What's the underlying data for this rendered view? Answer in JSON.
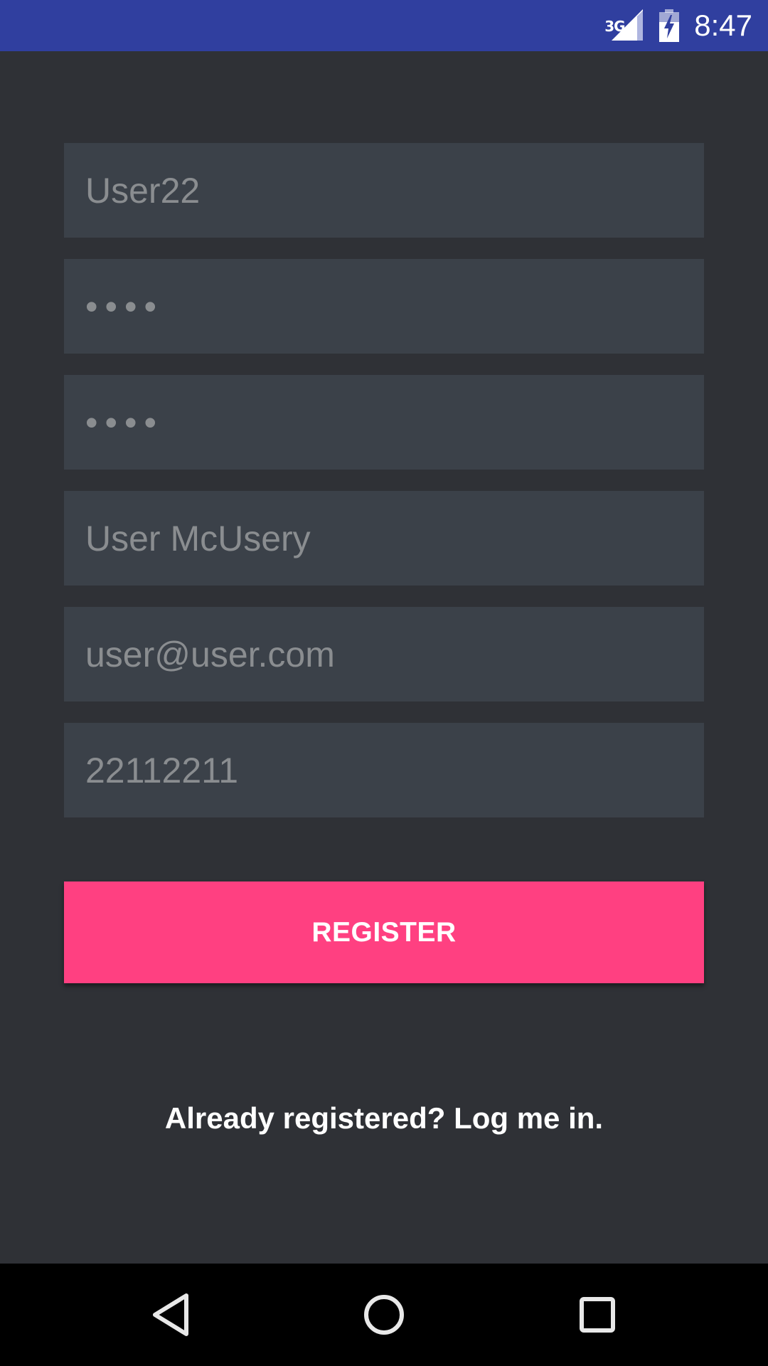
{
  "status_bar": {
    "network_type": "3G",
    "time": "8:47",
    "icons": [
      "signal-icon",
      "battery-charging-icon"
    ],
    "color": "#303f9f"
  },
  "form": {
    "fields": [
      {
        "name": "username",
        "value": "User22",
        "type": "text"
      },
      {
        "name": "password",
        "value": "••••",
        "type": "password"
      },
      {
        "name": "confirm-password",
        "value": "••••",
        "type": "password"
      },
      {
        "name": "full-name",
        "value": "User McUsery",
        "type": "text"
      },
      {
        "name": "email",
        "value": "user@user.com",
        "type": "email"
      },
      {
        "name": "phone",
        "value": "22112211",
        "type": "tel"
      }
    ]
  },
  "register_button": {
    "label": "REGISTER",
    "color": "#ff4081"
  },
  "login_link": {
    "label": "Already registered? Log me in."
  },
  "nav_bar": {
    "icons": [
      "back-icon",
      "home-icon",
      "recents-icon"
    ]
  },
  "colors": {
    "background": "#2f3136",
    "field_background": "#3b4149",
    "field_text": "#8a8d90"
  }
}
